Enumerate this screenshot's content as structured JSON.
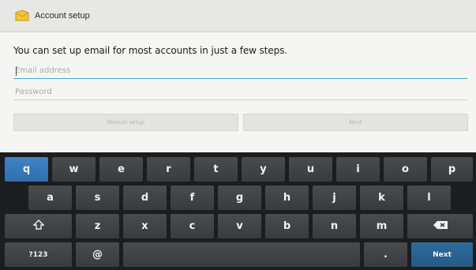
{
  "titlebar": {
    "title": "Account setup",
    "icon": "mail-icon"
  },
  "intro_text": "You can set up email for most accounts in just a few steps.",
  "email_field": {
    "value": "",
    "placeholder": "Email address"
  },
  "password_field": {
    "value": "",
    "placeholder": "Password"
  },
  "buttons": {
    "manual": "Manual setup",
    "next": "Next"
  },
  "keyboard": {
    "row1": [
      "q",
      "w",
      "e",
      "r",
      "t",
      "y",
      "u",
      "i",
      "o",
      "p"
    ],
    "row2": [
      "a",
      "s",
      "d",
      "f",
      "g",
      "h",
      "j",
      "k",
      "l"
    ],
    "row3": [
      "z",
      "x",
      "c",
      "v",
      "b",
      "n",
      "m"
    ],
    "symbols": "?123",
    "at": "@",
    "period": ".",
    "action": "Next",
    "shift_icon": "shift-icon",
    "backspace_icon": "backspace-icon"
  },
  "colors": {
    "accent": "#4aa8c9",
    "active_key": "#3f84c4",
    "keyboard_bg": "#1c1d1f",
    "key_bg": "#434447"
  }
}
